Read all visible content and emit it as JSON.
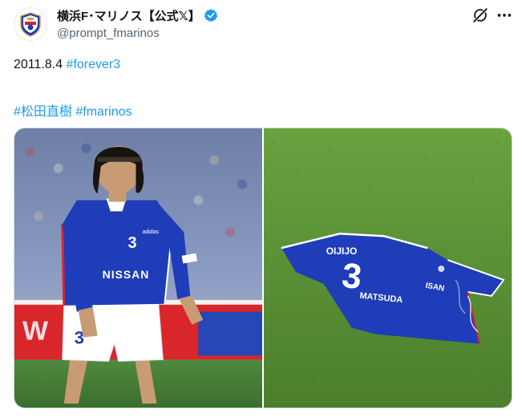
{
  "account": {
    "display_name": "横浜F･マリノス【公式𝕏】",
    "handle": "@prompt_fmarinos",
    "avatar_icon": "fmarinos-crest-icon",
    "verified_icon": "verified-badge-icon"
  },
  "tweet": {
    "date_text": "2011.8.4",
    "hashtag_forever": "#forever3",
    "hashtag_player": "#松田直樹",
    "hashtag_club": "#fmarinos"
  },
  "media": {
    "left_photo": {
      "shirt_number": "3",
      "sponsor": "NISSAN",
      "kit_brand": "adidas"
    },
    "right_photo": {
      "shirt_number": "3",
      "shirt_name": "MATSUDA",
      "sponsor_partial": "ISAN",
      "back_sponsor": "OIJIJO"
    }
  },
  "header_icons": [
    "grok-icon",
    "more-icon"
  ],
  "colors": {
    "link": "#1d9bf0",
    "text": "#0f1419",
    "secondary": "#536471",
    "verified": "#1d9bf0",
    "kit_blue": "#1f3db8"
  }
}
